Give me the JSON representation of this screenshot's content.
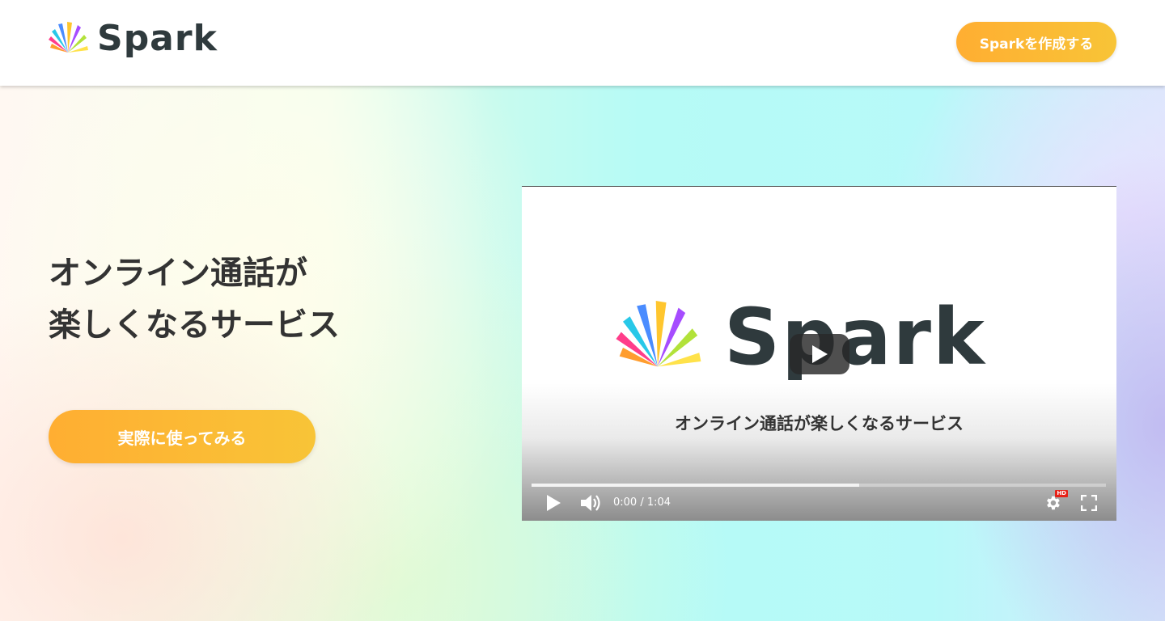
{
  "header": {
    "logo_text": "Spark",
    "cta_label": "Sparkを作成する"
  },
  "hero": {
    "headline_line1": "オンライン通話が",
    "headline_line2": "楽しくなるサービス",
    "cta_label": "実際に使ってみる"
  },
  "video": {
    "logo_text": "Spark",
    "tagline": "オンライン通話が楽しくなるサービス",
    "time_display": "0:00 / 1:04",
    "loaded_fraction": 0.57,
    "hd_badge": "HD"
  },
  "colors": {
    "accent_start": "#ffae32",
    "accent_end": "#f8c437",
    "text_dark": "#333333"
  },
  "icons": [
    "spark-logo-icon",
    "play-icon",
    "volume-icon",
    "settings-icon",
    "fullscreen-icon"
  ]
}
